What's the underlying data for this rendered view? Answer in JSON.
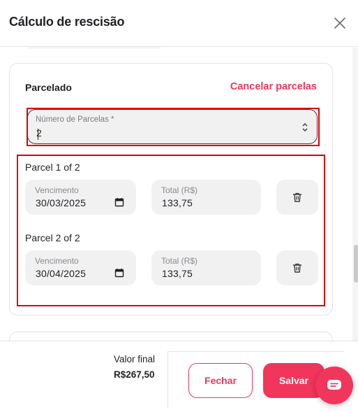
{
  "modal": {
    "title": "Cálculo de rescisão",
    "close_icon": "close-icon"
  },
  "installments": {
    "title": "Parcelado",
    "cancel_label": "Cancelar parcelas",
    "count_label": "Número de Parcelas *",
    "count_value": "2",
    "parcels": [
      {
        "title": "Parcel 1 of 2",
        "due_label": "Vencimento",
        "due_value": "30/03/2025",
        "total_label": "Total (R$)",
        "total_value": "133,75"
      },
      {
        "title": "Parcel 2 of 2",
        "due_label": "Vencimento",
        "due_value": "30/04/2025",
        "total_label": "Total (R$)",
        "total_value": "133,75"
      }
    ]
  },
  "footer": {
    "total_label": "Valor final",
    "total_value": "R$267,50",
    "close_label": "Fechar",
    "save_label": "Salvar"
  },
  "colors": {
    "accent": "#f0365a",
    "highlight": "#e00000",
    "field_bg": "#f1f1f2"
  },
  "icons": [
    "close-icon",
    "calendar-icon",
    "trash-icon",
    "spinner-icon",
    "chat-icon"
  ]
}
